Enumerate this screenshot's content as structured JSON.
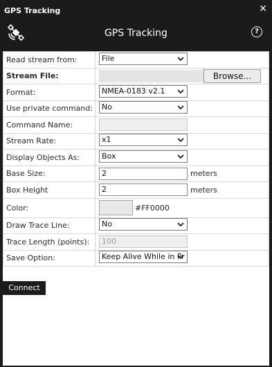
{
  "window": {
    "title": "GPS Tracking"
  },
  "header": {
    "title": "GPS Tracking",
    "help_label": "?"
  },
  "form": {
    "read_stream": {
      "label": "Read stream from:",
      "value": "File"
    },
    "stream_file": {
      "label": "Stream File:",
      "value": "",
      "browse_label": "Browse..."
    },
    "format": {
      "label": "Format:",
      "value": "NMEA-0183 v2.1"
    },
    "private_command": {
      "label": "Use private command:",
      "value": "No"
    },
    "command_name": {
      "label": "Command Name:",
      "value": ""
    },
    "stream_rate": {
      "label": "Stream Rate:",
      "value": "x1"
    },
    "display_objects": {
      "label": "Display Objects As:",
      "value": "Box"
    },
    "base_size": {
      "label": "Base Size:",
      "value": "2",
      "unit": "meters"
    },
    "box_height": {
      "label": "Box Height",
      "value": "2",
      "unit": "meters"
    },
    "color": {
      "label": "Color:",
      "value": "#FF0000"
    },
    "draw_trace": {
      "label": "Draw Trace Line:",
      "value": "No"
    },
    "trace_length": {
      "label": "Trace Length (points):",
      "value": "100"
    },
    "save_option": {
      "label": "Save Option:",
      "value": "Keep Alive While in Pr"
    }
  },
  "actions": {
    "connect_label": "Connect"
  },
  "colors": {
    "chrome": "#1b1b1b",
    "panel": "#ffffff",
    "swatch": "#e8e8e8"
  }
}
